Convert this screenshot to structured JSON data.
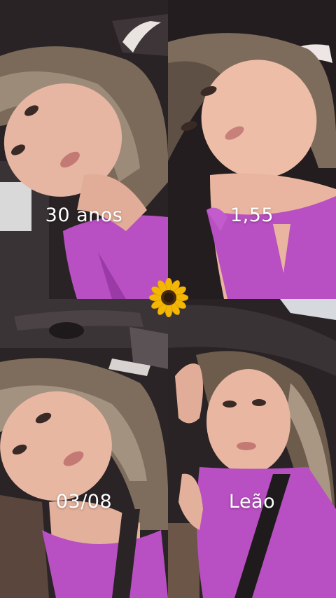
{
  "panels": [
    {
      "id": "top-left",
      "caption": "30 anos"
    },
    {
      "id": "top-right",
      "caption": "1,55"
    },
    {
      "id": "bottom-left",
      "caption": "03/08"
    },
    {
      "id": "bottom-right",
      "caption": "Leão"
    }
  ],
  "decoration": {
    "icon": "sunflower-icon"
  },
  "colors": {
    "top": "#f2cfc3",
    "shirt": "#b84fc2",
    "hair": "#6d5a4a",
    "car_interior": "#2b2426"
  }
}
